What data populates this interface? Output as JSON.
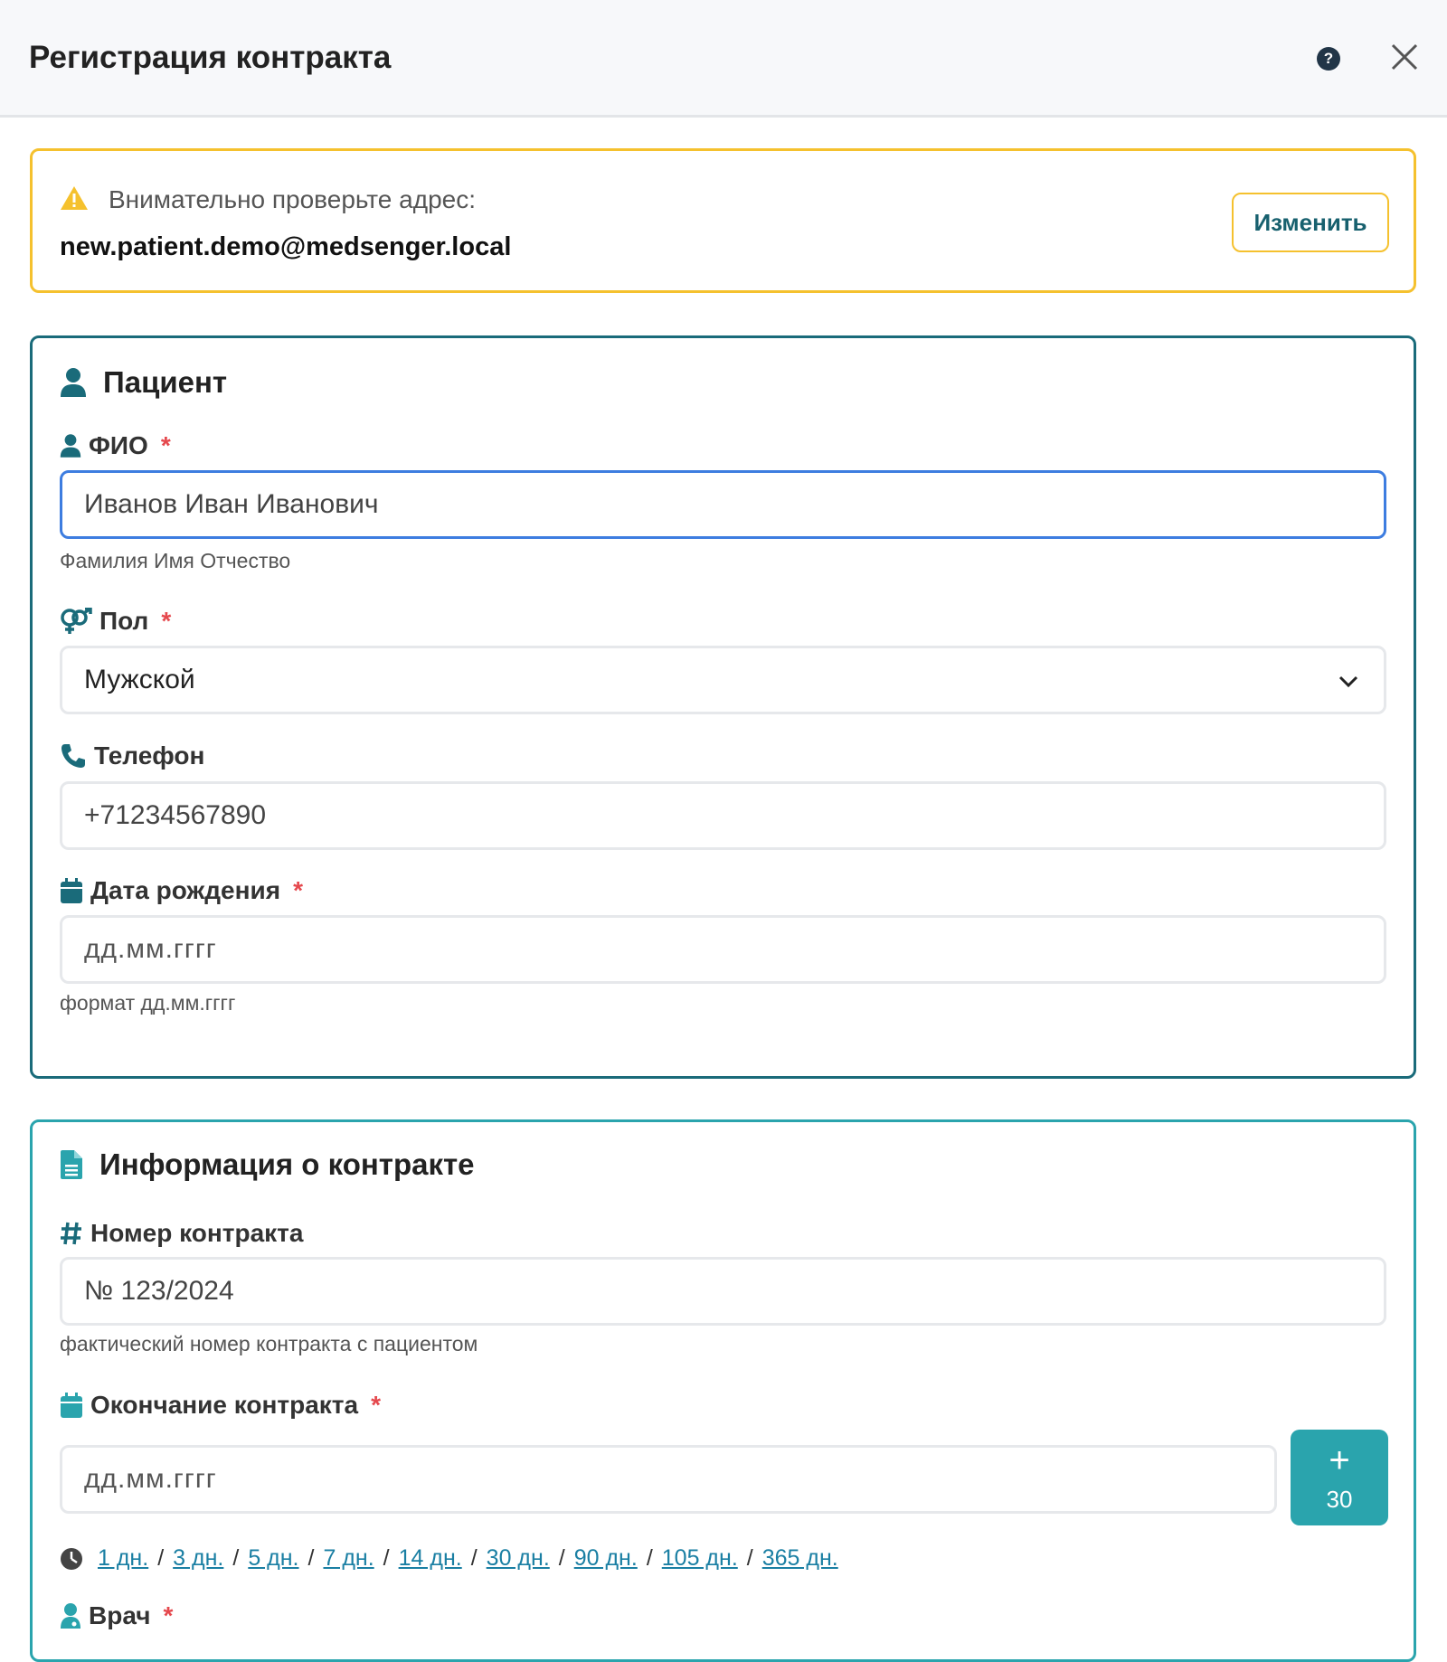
{
  "header": {
    "title": "Регистрация контракта",
    "help_glyph": "?"
  },
  "warning": {
    "message": "Внимательно проверьте адрес:",
    "email": "new.patient.demo@medsenger.local",
    "change_label": "Изменить"
  },
  "patient": {
    "title": "Пациент",
    "fio": {
      "label": "ФИО",
      "value": "Иванов Иван Иванович",
      "hint": "Фамилия Имя Отчество"
    },
    "sex": {
      "label": "Пол",
      "value": "Мужской"
    },
    "phone": {
      "label": "Телефон",
      "value": "+71234567890"
    },
    "birth": {
      "label": "Дата рождения",
      "placeholder": "дд.мм.гггг",
      "hint": "формат дд.мм.гггг"
    },
    "required_mark": "*"
  },
  "contract": {
    "title": "Информация о контракте",
    "number": {
      "label": "Номер контракта",
      "value": "№ 123/2024",
      "hint": "фактический номер контракта с пациентом"
    },
    "end": {
      "label": "Окончание контракта",
      "placeholder": "дд.мм.гггг"
    },
    "plus_button": {
      "symbol": "+",
      "days": "30"
    },
    "quick_days": [
      "1 дн.",
      "3 дн.",
      "5 дн.",
      "7 дн.",
      "14 дн.",
      "30 дн.",
      "90 дн.",
      "105 дн.",
      "365 дн."
    ],
    "doctor": {
      "label": "Врач"
    },
    "required_mark": "*"
  },
  "colors": {
    "accent": "#1a6b7a",
    "teal": "#2aa4ad",
    "warning": "#f5c12e",
    "required": "#e5484d",
    "link": "#1a7fa3"
  }
}
